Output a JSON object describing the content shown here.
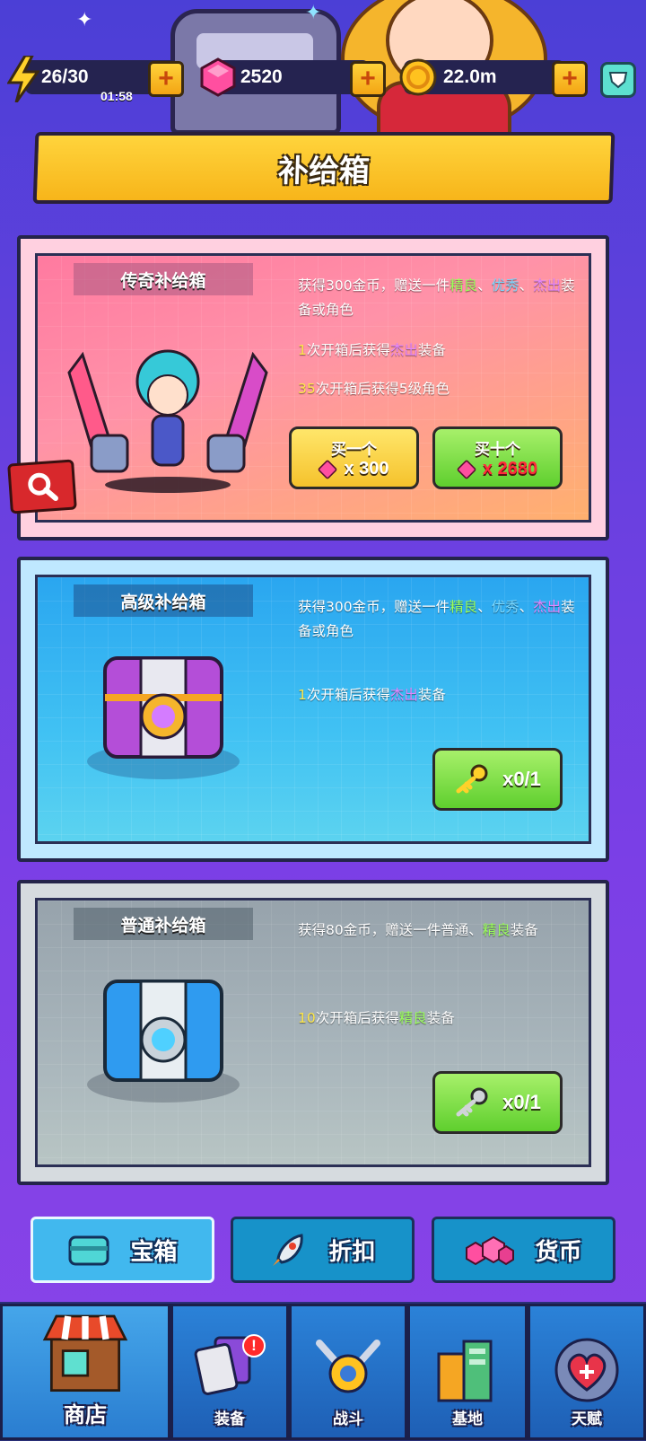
{
  "resources": {
    "energy": "26/30",
    "timer": "01:58",
    "gems": "2520",
    "coins": "22.0m"
  },
  "title": "补给箱",
  "crates": [
    {
      "name": "传奇补给箱",
      "desc1": {
        "pre": "获得300金币，赠送一件",
        "a": "精良",
        "sep1": "、",
        "b": "优秀",
        "sep2": "、",
        "c": "杰出",
        "post": "装备或角色"
      },
      "line2": {
        "num": "1",
        "pre": "次开箱后获得",
        "q": "杰出",
        "post": "装备"
      },
      "line3": {
        "num": "35",
        "text": "次开箱后获得5级角色"
      },
      "buy_one": {
        "label": "买一个",
        "price": "x 300"
      },
      "buy_ten": {
        "label": "买十个",
        "price": "x 2680"
      }
    },
    {
      "name": "高级补给箱",
      "desc1": {
        "pre": "获得300金币，赠送一件",
        "a": "精良",
        "sep1": "、",
        "b": "优秀",
        "sep2": "、",
        "c": "杰出",
        "post": "装备或角色"
      },
      "line2": {
        "num": "1",
        "pre": "次开箱后获得",
        "q": "杰出",
        "post": "装备"
      },
      "key": "x0/1"
    },
    {
      "name": "普通补给箱",
      "desc1": {
        "pre": "获得80金币，赠送一件",
        "a": "普通",
        "sep1": "、",
        "b": "精良",
        "post": "装备"
      },
      "line2": {
        "num": "10",
        "pre": "次开箱后获得",
        "q": "精良",
        "post": "装备"
      },
      "key": "x0/1"
    }
  ],
  "tabs": [
    "宝箱",
    "折扣",
    "货币"
  ],
  "nav": [
    "商店",
    "装备",
    "战斗",
    "基地",
    "天赋"
  ],
  "nav_badge": "!",
  "colors": {
    "gold": "#f7b51a",
    "green": "#5fcf2e",
    "blue": "#1792c9",
    "pink": "#ff7aa0"
  }
}
